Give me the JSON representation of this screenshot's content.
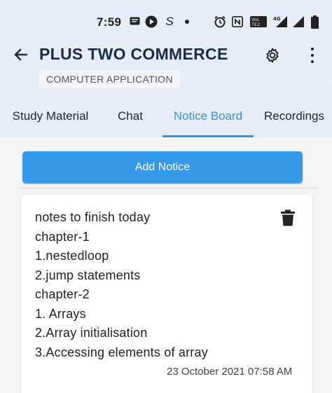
{
  "status_bar": {
    "time": "7:59",
    "icons": [
      "message-icon",
      "play-icon",
      "swipe-icon",
      "dot-icon",
      "alarm-icon",
      "nfc-icon",
      "volte-icon",
      "signal-4g-icon",
      "signal-icon",
      "battery-icon"
    ],
    "volte_label": "VoLTE2",
    "network_label": "4G"
  },
  "app_bar": {
    "title": "PLUS TWO COMMERCE",
    "subtitle": "COMPUTER APPLICATION"
  },
  "tabs": [
    {
      "label": "Study Material",
      "active": false
    },
    {
      "label": "Chat",
      "active": false
    },
    {
      "label": "Notice Board",
      "active": true
    },
    {
      "label": "Recordings",
      "active": false
    }
  ],
  "add_notice_label": "Add Notice",
  "notice": {
    "lines": [
      "notes to finish today",
      "chapter-1",
      "1.nestedloop",
      "2.jump statements",
      "chapter-2",
      "1. Arrays",
      "2.Array initialisation",
      "3.Accessing elements of array"
    ],
    "timestamp": "23 October 2021 07:58 AM"
  },
  "colors": {
    "accent": "#3a8edc",
    "button": "#3399e8",
    "header_bg": "#e6edf6",
    "title": "#1b2b4b"
  }
}
